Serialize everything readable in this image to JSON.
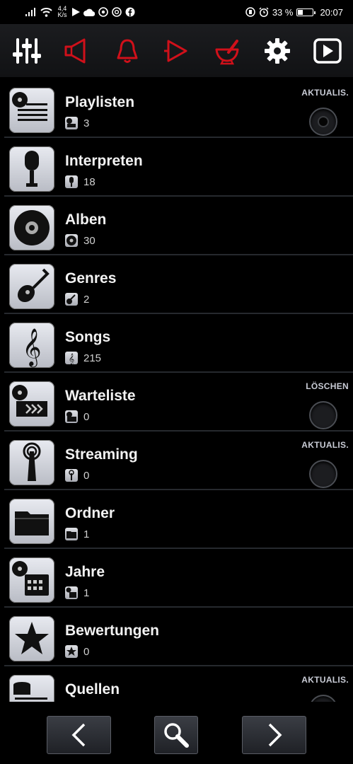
{
  "status_bar": {
    "speed_value": "4,4",
    "speed_unit": "K/s",
    "battery_percent": "33 %",
    "battery_level": 0.33,
    "time": "20:07"
  },
  "toolbar": {
    "icons": [
      "equalizer-icon",
      "speaker-red-icon",
      "bell-red-icon",
      "play-outline-red-icon",
      "mortar-red-icon",
      "gear-icon",
      "play-button-icon"
    ],
    "accent_red": "#d0101a"
  },
  "list": {
    "items": [
      {
        "title": "Playlisten",
        "count": "3",
        "action": "AKTUALIS.",
        "icon": "playlist-icon"
      },
      {
        "title": "Interpreten",
        "count": "18",
        "action": "",
        "icon": "microphone-icon"
      },
      {
        "title": "Alben",
        "count": "30",
        "action": "",
        "icon": "disc-icon"
      },
      {
        "title": "Genres",
        "count": "2",
        "action": "",
        "icon": "guitar-icon"
      },
      {
        "title": "Songs",
        "count": "215",
        "action": "",
        "icon": "treble-clef-icon"
      },
      {
        "title": "Warteliste",
        "count": "0",
        "action": "LÖSCHEN",
        "icon": "queue-icon"
      },
      {
        "title": "Streaming",
        "count": "0",
        "action": "AKTUALIS.",
        "icon": "antenna-icon"
      },
      {
        "title": "Ordner",
        "count": "1",
        "action": "",
        "icon": "folder-icon"
      },
      {
        "title": "Jahre",
        "count": "1",
        "action": "",
        "icon": "calendar-icon"
      },
      {
        "title": "Bewertungen",
        "count": "0",
        "action": "",
        "icon": "star-icon"
      },
      {
        "title": "Quellen",
        "count": "",
        "action": "AKTUALIS.",
        "icon": "sources-icon"
      }
    ]
  },
  "bottom_nav": {
    "buttons": [
      "previous-button",
      "search-button",
      "next-button"
    ]
  }
}
